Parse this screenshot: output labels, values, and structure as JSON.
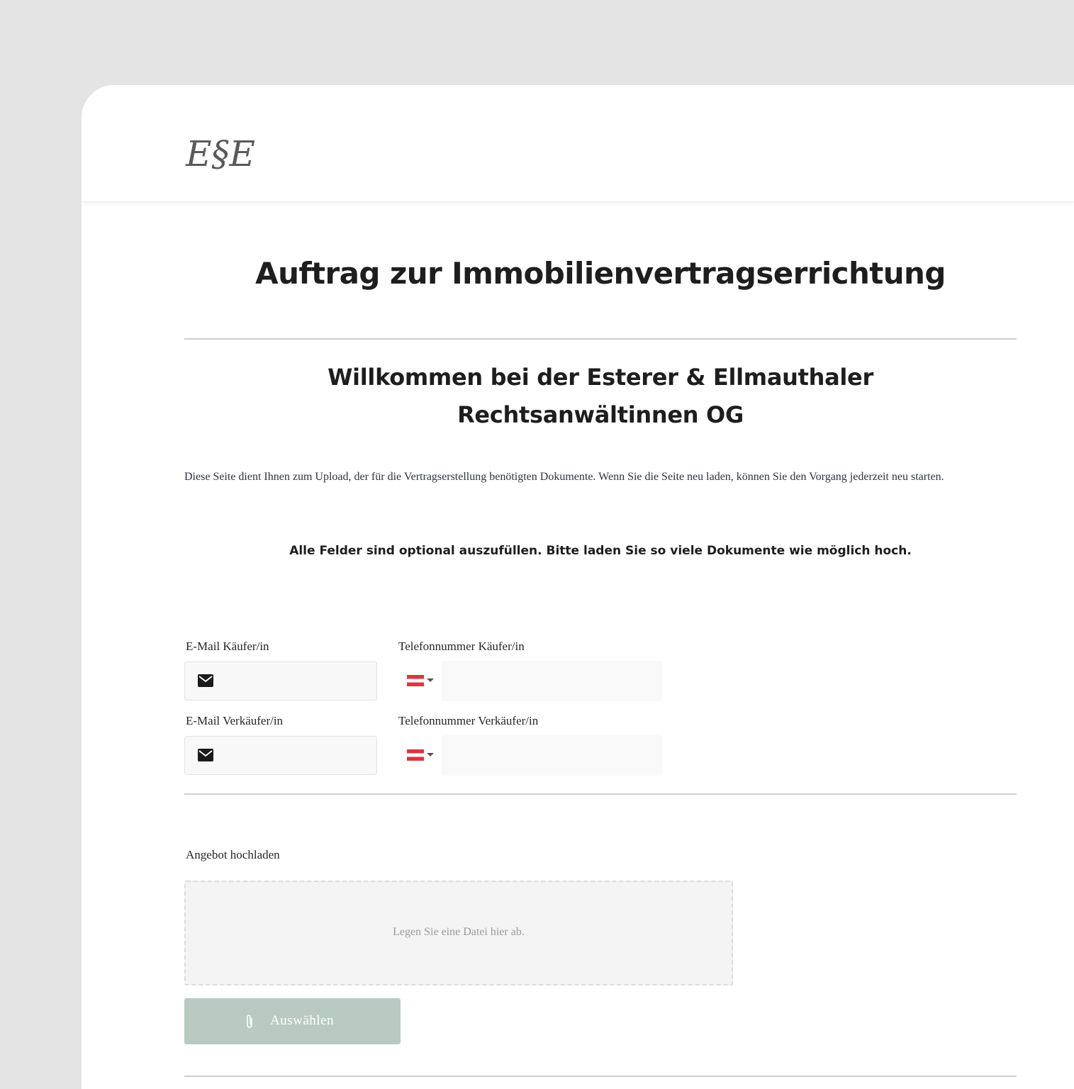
{
  "brand": {
    "logo_text": "E§E",
    "logo_color": "#5a5a5a"
  },
  "page": {
    "title": "Auftrag zur Immobilienvertragserrichtung",
    "welcome_line1": "Willkommen bei der Esterer & Ellmauthaler",
    "welcome_line2": "Rechtsanwältinnen OG",
    "intro": "Diese Seite dient Ihnen zum Upload, der für die Vertragserstellung benötigten Dokumente. Wenn Sie die Seite neu laden, können Sie den Vorgang jederzeit neu starten.",
    "note": "Alle Felder sind optional auszufüllen. Bitte laden Sie so viele Dokumente wie möglich hoch."
  },
  "form": {
    "buyer_email_label": "E-Mail Käufer/in",
    "buyer_phone_label": "Telefonnummer Käufer/in",
    "seller_email_label": "E-Mail Verkäufer/in",
    "seller_phone_label": "Telefonnummer Verkäufer/in",
    "email_icon": "envelope-icon",
    "country_flag": "austria-flag-icon",
    "flag_colors": [
      "#d9363e",
      "#ffffff",
      "#d9363e"
    ]
  },
  "upload": {
    "label": "Angebot hochladen",
    "dropzone_text": "Legen Sie eine Datei hier ab.",
    "button_label": "Auswählen",
    "button_icon": "paperclip-icon",
    "button_color": "#b8cac1"
  }
}
